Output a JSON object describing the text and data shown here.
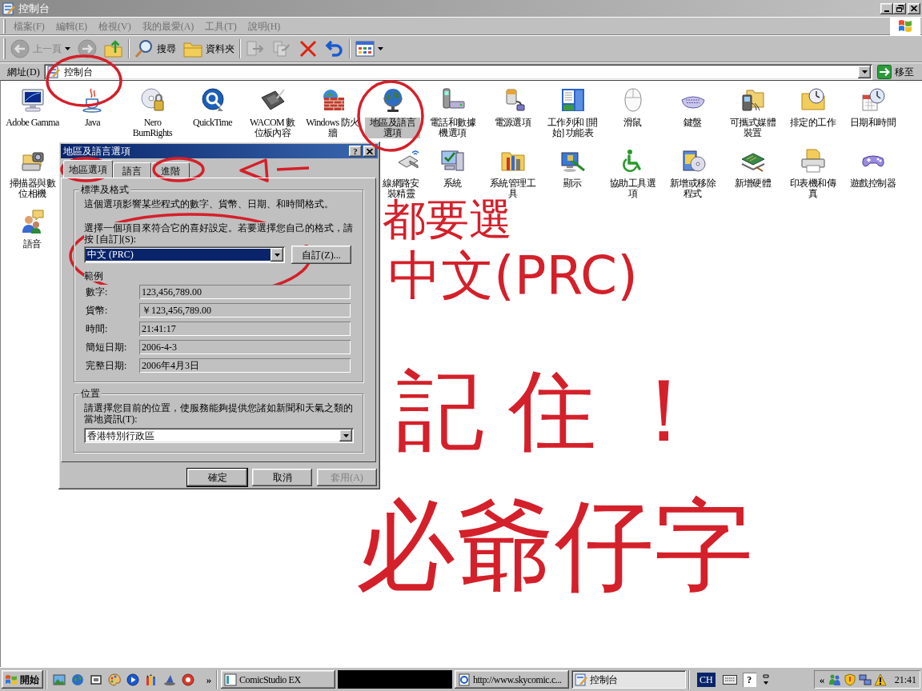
{
  "window": {
    "title": "控制台"
  },
  "menu_bar": {
    "items": [
      "檔案(F)",
      "編輯(E)",
      "檢視(V)",
      "我的最愛(A)",
      "工具(T)",
      "說明(H)"
    ]
  },
  "toolbar": {
    "groups": [
      [
        {
          "kind": "back",
          "label": "上一頁",
          "disabled": true
        },
        {
          "kind": "forward",
          "disabled": true
        },
        {
          "kind": "up",
          "disabled": false
        }
      ],
      [
        {
          "kind": "search",
          "label": "搜尋",
          "disabled": false
        },
        {
          "kind": "folders",
          "label": "資料夾",
          "disabled": false
        }
      ],
      [
        {
          "kind": "move",
          "disabled": true
        },
        {
          "kind": "copy",
          "disabled": true
        },
        {
          "kind": "delete",
          "disabled": false
        },
        {
          "kind": "undo",
          "disabled": false
        }
      ],
      [
        {
          "kind": "views",
          "disabled": false
        }
      ]
    ]
  },
  "address_bar": {
    "label": "網址(D)",
    "value": "控制台",
    "go_button": "移至"
  },
  "control_panel": {
    "items": [
      {
        "label": "Adobe Gamma",
        "selected": false
      },
      {
        "label": "Java",
        "selected": false
      },
      {
        "label": "Nero BurnRights",
        "selected": false
      },
      {
        "label": "QuickTime",
        "selected": false
      },
      {
        "label": "WACOM 數位板內容",
        "selected": false
      },
      {
        "label": "Windows 防火牆",
        "selected": false
      },
      {
        "label": "地區及語言選項",
        "selected": true
      },
      {
        "label": "電話和數據機選項",
        "selected": false
      },
      {
        "label": "電源選項",
        "selected": false
      },
      {
        "label": "工作列和 [開始] 功能表",
        "selected": false
      },
      {
        "label": "滑鼠",
        "selected": false
      },
      {
        "label": "鍵盤",
        "selected": false
      },
      {
        "label": "可攜式媒體裝置",
        "selected": false
      },
      {
        "label": "排定的工作",
        "selected": false
      },
      {
        "label": "日期和時間",
        "selected": false
      },
      {
        "label": "掃描器與數位相機",
        "selected": false
      },
      {
        "label": "線網路安裝精靈",
        "selected": false
      },
      {
        "label": "系統",
        "selected": false
      },
      {
        "label": "系統管理工具",
        "selected": false
      },
      {
        "label": "顯示",
        "selected": false
      },
      {
        "label": "協助工具選項",
        "selected": false
      },
      {
        "label": "新增或移除程式",
        "selected": false
      },
      {
        "label": "新增硬體",
        "selected": false
      },
      {
        "label": "印表機和傳真",
        "selected": false
      },
      {
        "label": "遊戲控制器",
        "selected": false
      },
      {
        "label": "語音",
        "selected": false
      }
    ]
  },
  "dialog": {
    "title": "地區及語言選項",
    "help_button": "?",
    "tabs": [
      {
        "label": "地區選項",
        "selected": true
      },
      {
        "label": "語言",
        "selected": false
      },
      {
        "label": "進階",
        "selected": false
      }
    ],
    "standards_group": {
      "title": "標準及格式",
      "description": "這個選項影響某些程式的數字、貨幣、日期、和時間格式。",
      "instruction": "選擇一個項目來符合它的喜好設定。若要選擇您自己的格式，請按 [自訂](S):",
      "format_select": "中文 (PRC)",
      "customize_button": "自訂(Z)...",
      "samples_label": "範例",
      "samples": [
        {
          "label": "數字:",
          "value": "123,456,789.00"
        },
        {
          "label": "貨幣:",
          "value": "￥123,456,789.00"
        },
        {
          "label": "時間:",
          "value": "21:41:17"
        },
        {
          "label": "簡短日期:",
          "value": "2006-4-3"
        },
        {
          "label": "完整日期:",
          "value": "2006年4月3日"
        }
      ]
    },
    "location_group": {
      "title": "位置",
      "description": "請選擇您目前的位置，使服務能夠提供您諸如新聞和天氣之類的當地資訊(T):",
      "location_select": "香港特別行政區"
    },
    "buttons": [
      {
        "label": "確定",
        "default": true,
        "disabled": false
      },
      {
        "label": "取消",
        "default": false,
        "disabled": false
      },
      {
        "label": "套用(A)",
        "default": false,
        "disabled": true
      }
    ]
  },
  "taskbar": {
    "start": "開始",
    "overflow": "»",
    "tasks": [
      {
        "kind": "app",
        "label": "ComicStudio EX",
        "selected": false
      },
      {
        "kind": "redacted"
      },
      {
        "kind": "browser",
        "label": "http://www.skycomic.c...",
        "selected": false
      },
      {
        "kind": "folder",
        "label": "控制台",
        "selected": true
      }
    ],
    "language": "CH",
    "help": "?",
    "tray_expand": "«",
    "clock": "21:41"
  },
  "annotations": {
    "handwriting": [
      "都要選",
      "中文(PRC)",
      "記住！",
      "必爺仔字"
    ]
  }
}
